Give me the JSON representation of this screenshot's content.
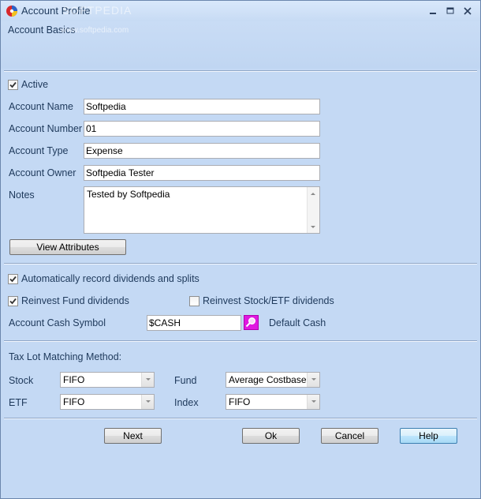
{
  "window": {
    "title": "Account Profile",
    "watermark": "SOFTPEDIA"
  },
  "section": {
    "label": "Account Basics",
    "watermark": "www.softpedia.com"
  },
  "active": {
    "label": "Active",
    "checked": true
  },
  "fields": {
    "account_name": {
      "label": "Account Name",
      "value": "Softpedia"
    },
    "account_number": {
      "label": "Account Number",
      "value": "01"
    },
    "account_type": {
      "label": "Account Type",
      "value": "Expense"
    },
    "account_owner": {
      "label": "Account Owner",
      "value": "Softpedia Tester"
    },
    "notes": {
      "label": "Notes",
      "value": "Tested by Softpedia"
    }
  },
  "view_attributes_label": "View Attributes",
  "dividends": {
    "auto_record": {
      "label": "Automatically record dividends and splits",
      "checked": true
    },
    "reinvest_fund": {
      "label": "Reinvest Fund dividends",
      "checked": true
    },
    "reinvest_stock": {
      "label": "Reinvest Stock/ETF dividends",
      "checked": false
    },
    "cash_symbol_label": "Account Cash Symbol",
    "cash_symbol_value": "$CASH",
    "default_cash_label": "Default Cash"
  },
  "tax_lot": {
    "heading": "Tax Lot Matching Method:",
    "stock": {
      "label": "Stock",
      "value": "FIFO"
    },
    "etf": {
      "label": "ETF",
      "value": "FIFO"
    },
    "fund": {
      "label": "Fund",
      "value": "Average Costbase"
    },
    "index": {
      "label": "Index",
      "value": "FIFO"
    }
  },
  "buttons": {
    "next": "Next",
    "ok": "Ok",
    "cancel": "Cancel",
    "help": "Help"
  },
  "colors": {
    "window_bg": "#c4d9f4",
    "focus_border": "#3c7fb1",
    "symbol_button": "#e018e0"
  },
  "icons": {
    "app": "app-logo-icon",
    "minimize": "minimize-icon",
    "maximize": "maximize-icon",
    "close": "close-icon",
    "symbol_lookup": "lookup-icon"
  }
}
